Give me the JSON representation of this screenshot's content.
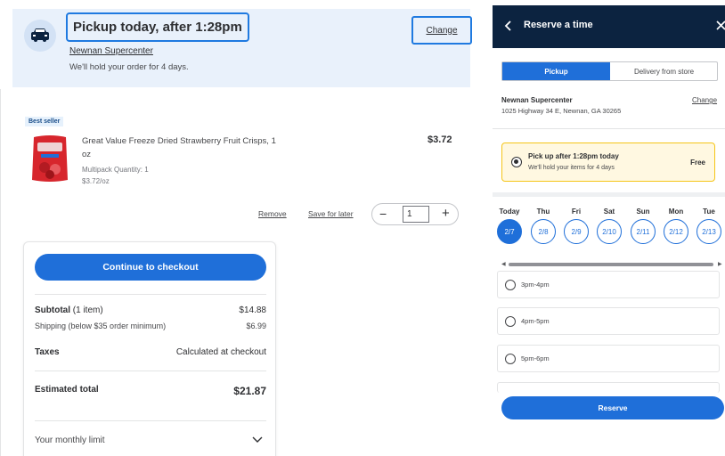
{
  "pickup_banner": {
    "title": "Pickup today, after 1:28pm",
    "store_name": "Newnan Supercenter",
    "hold_text": "We'll hold your order for 4 days.",
    "change_label": "Change"
  },
  "cart_item": {
    "badge": "Best seller",
    "name": "Great Value Freeze Dried Strawberry Fruit Crisps, 1 oz",
    "multipack": "Multipack Quantity: 1",
    "unit_price": "$3.72/oz",
    "price": "$3.72",
    "remove_label": "Remove",
    "save_label": "Save for later",
    "quantity": "1",
    "minus_symbol": "−",
    "plus_symbol": "+"
  },
  "summary": {
    "checkout_label": "Continue to checkout",
    "subtotal_label": "Subtotal",
    "subtotal_count": "(1 item)",
    "subtotal_value": "$14.88",
    "shipping_label": "Shipping (below $35 order minimum)",
    "shipping_value": "$6.99",
    "taxes_label": "Taxes",
    "taxes_value": "Calculated at checkout",
    "total_label": "Estimated total",
    "total_value": "$21.87",
    "limit_label": "Your monthly limit"
  },
  "reserve_panel": {
    "title": "Reserve a time",
    "tabs": [
      {
        "label": "Pickup",
        "selected": true
      },
      {
        "label": "Delivery from store",
        "selected": false
      }
    ],
    "store_name": "Newnan Supercenter",
    "store_address": "1025 Highway 34 E, Newnan, GA 30265",
    "change_label": "Change",
    "option": {
      "title": "Pick up after 1:28pm today",
      "subtitle": "We'll hold your items for 4 days",
      "price": "Free"
    },
    "days": [
      {
        "name": "Today",
        "date": "2/7",
        "selected": true
      },
      {
        "name": "Thu",
        "date": "2/8",
        "selected": false
      },
      {
        "name": "Fri",
        "date": "2/9",
        "selected": false
      },
      {
        "name": "Sat",
        "date": "2/10",
        "selected": false
      },
      {
        "name": "Sun",
        "date": "2/11",
        "selected": false
      },
      {
        "name": "Mon",
        "date": "2/12",
        "selected": false
      },
      {
        "name": "Tue",
        "date": "2/13",
        "selected": false
      }
    ],
    "slots": [
      {
        "label": "3pm-4pm"
      },
      {
        "label": "4pm-5pm"
      },
      {
        "label": "5pm-6pm"
      }
    ],
    "reserve_label": "Reserve"
  },
  "colors": {
    "accent_blue": "#1f6fd9",
    "header_navy": "#0c2340",
    "banner_bg": "#e9f1fb",
    "option_highlight": "#f5c518"
  }
}
